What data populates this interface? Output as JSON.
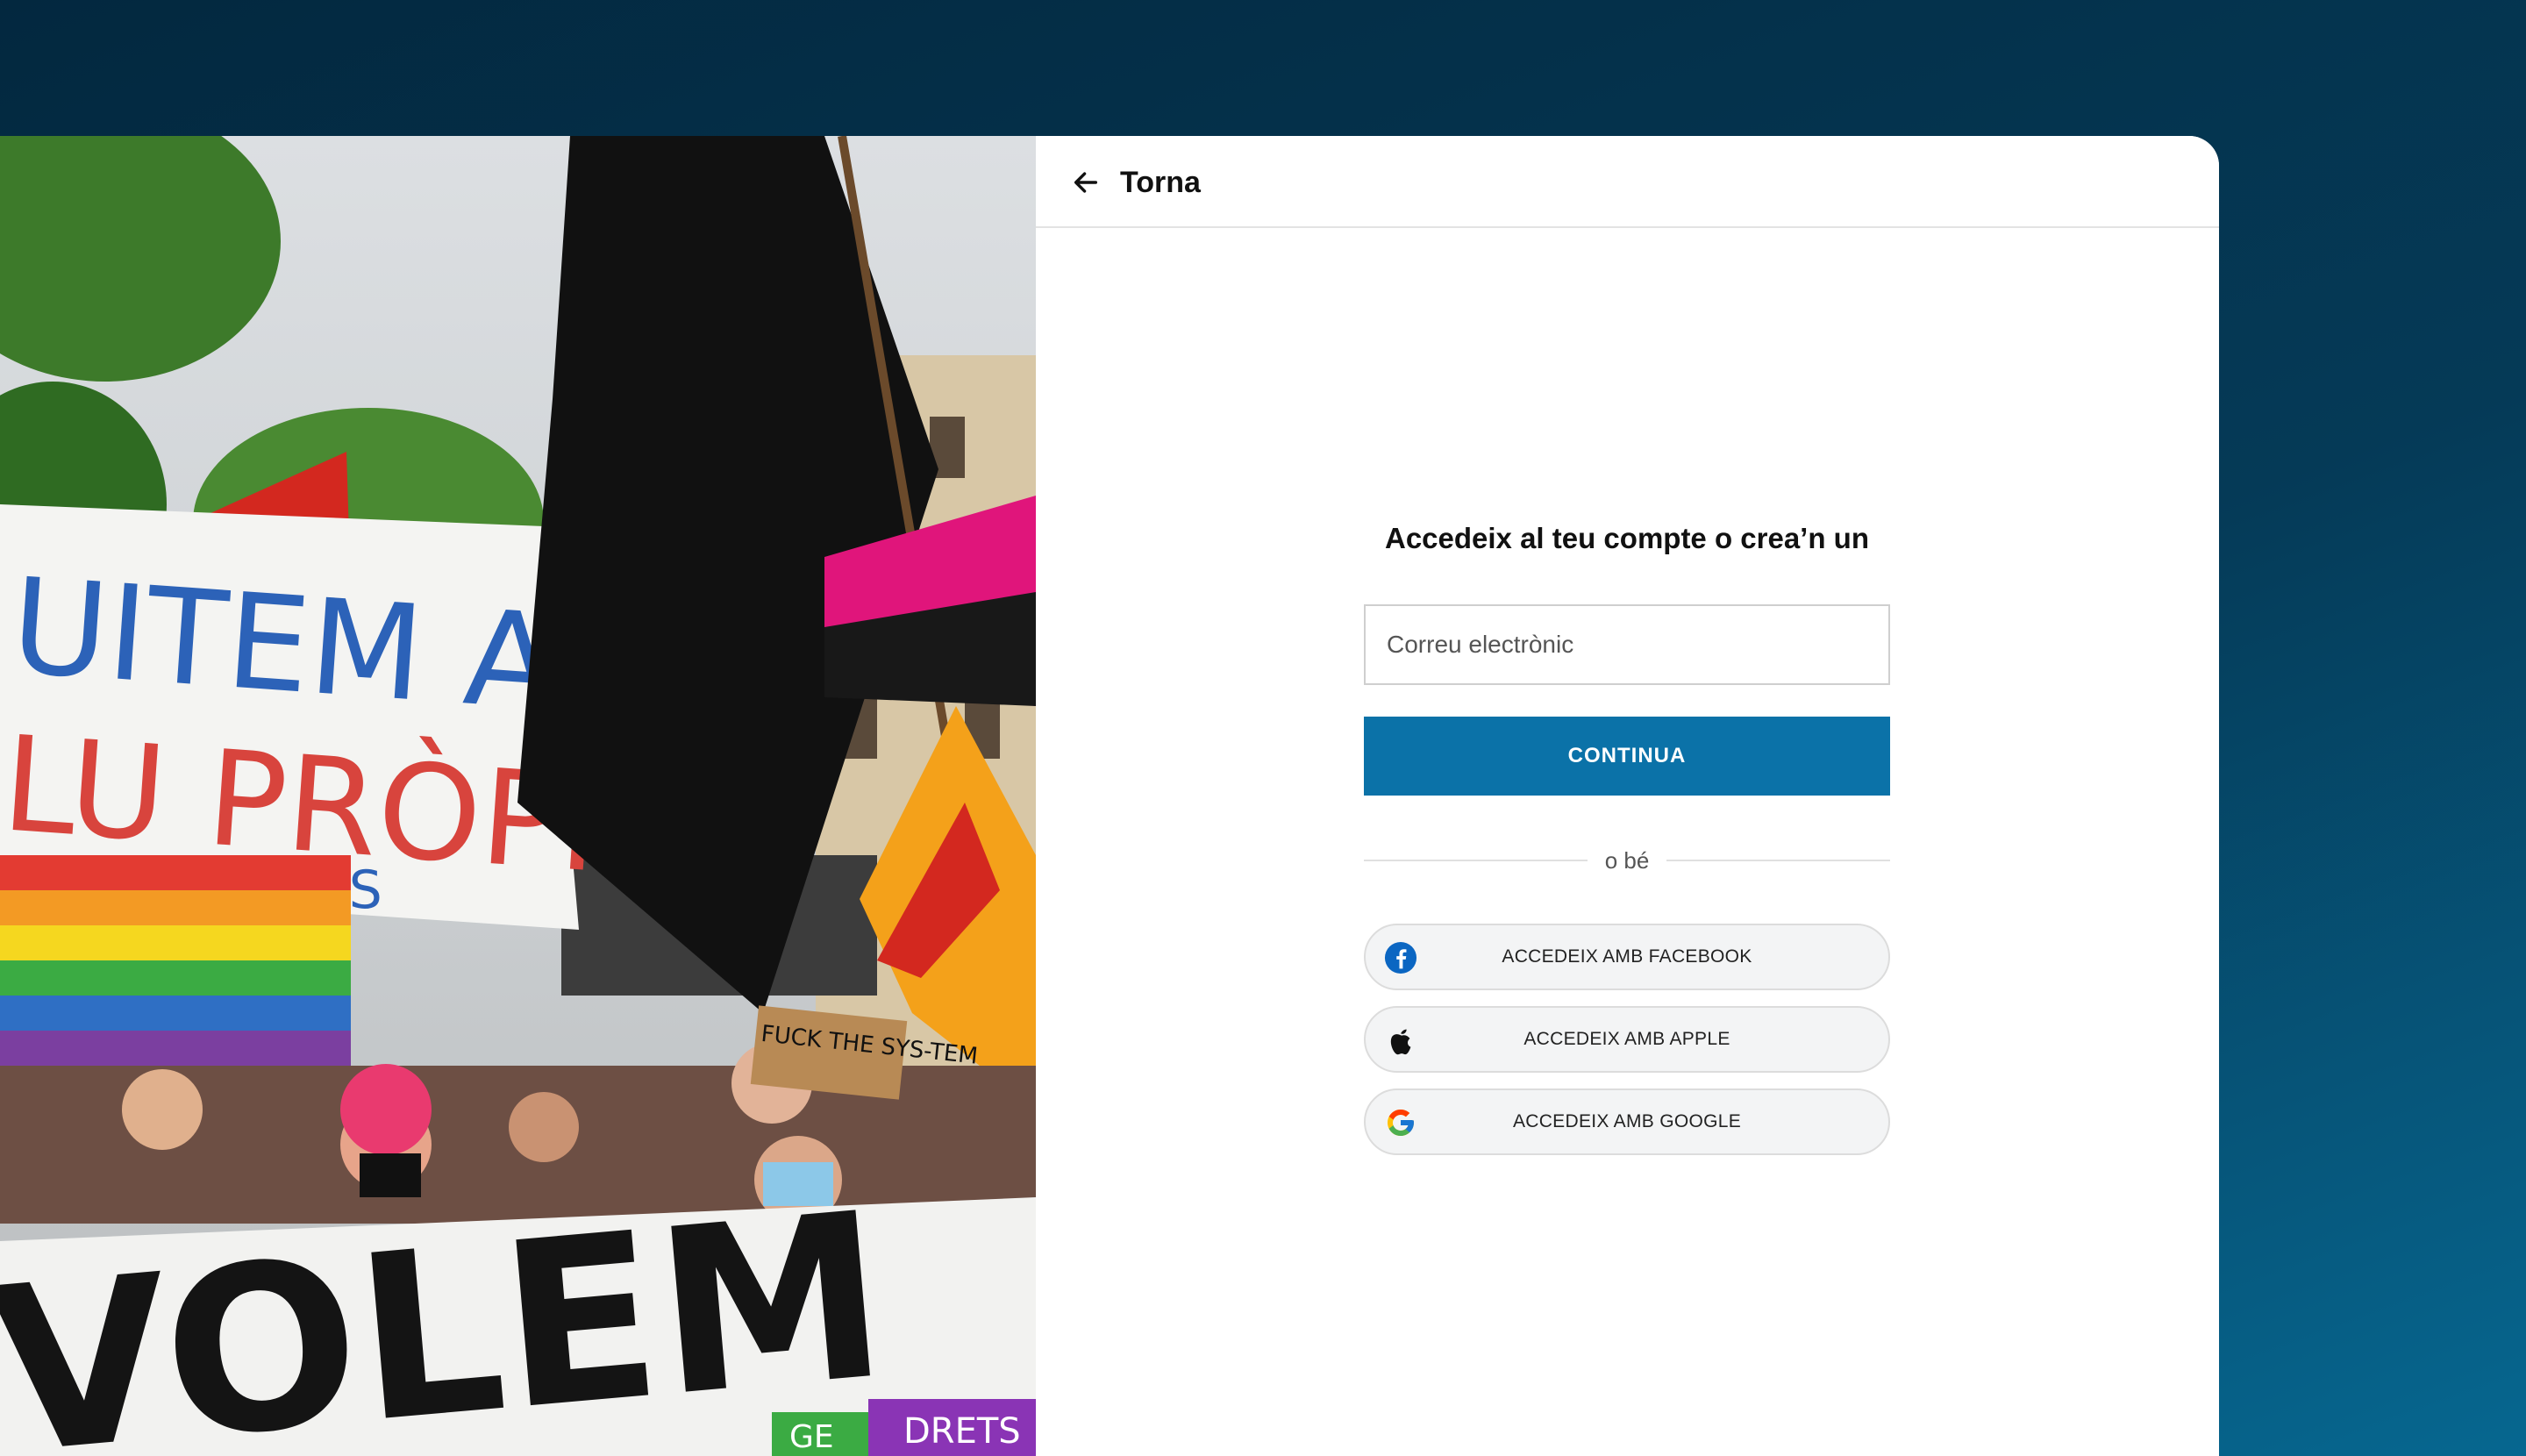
{
  "header": {
    "back_label": "Torna"
  },
  "login": {
    "title": "Accedeix al teu compte o crea’n un",
    "email_placeholder": "Correu electrònic",
    "continue_label": "CONTINUA",
    "divider_text": "o bé"
  },
  "social": {
    "facebook_label": "ACCEDEIX AMB FACEBOOK",
    "apple_label": "ACCEDEIX AMB APPLE",
    "google_label": "ACCEDEIX AMB GOOGLE"
  },
  "photo": {
    "banner_top_line1": "UITEM AMB",
    "banner_top_line2": "LU PRÒPIA",
    "banner_top_line3": "IS",
    "sign_text": "FUCK THE SYS-TEM",
    "banner_bottom": "VOLEM",
    "banner_bottom_small": "DRETS",
    "banner_bottom_small2": "GE"
  },
  "colors": {
    "background": "#053a57",
    "accent": "#0b72a8",
    "facebook": "#1877f2"
  }
}
